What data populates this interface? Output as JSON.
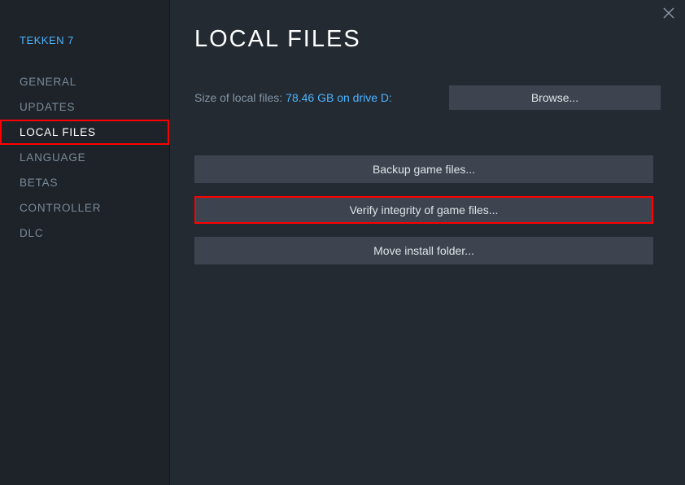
{
  "game_title": "TEKKEN 7",
  "sidebar": {
    "items": [
      {
        "label": "GENERAL"
      },
      {
        "label": "UPDATES"
      },
      {
        "label": "LOCAL FILES"
      },
      {
        "label": "LANGUAGE"
      },
      {
        "label": "BETAS"
      },
      {
        "label": "CONTROLLER"
      },
      {
        "label": "DLC"
      }
    ]
  },
  "main": {
    "title": "LOCAL FILES",
    "size_label": "Size of local files:",
    "size_value": "78.46 GB on drive D:",
    "browse_label": "Browse...",
    "backup_label": "Backup game files...",
    "verify_label": "Verify integrity of game files...",
    "move_label": "Move install folder..."
  }
}
